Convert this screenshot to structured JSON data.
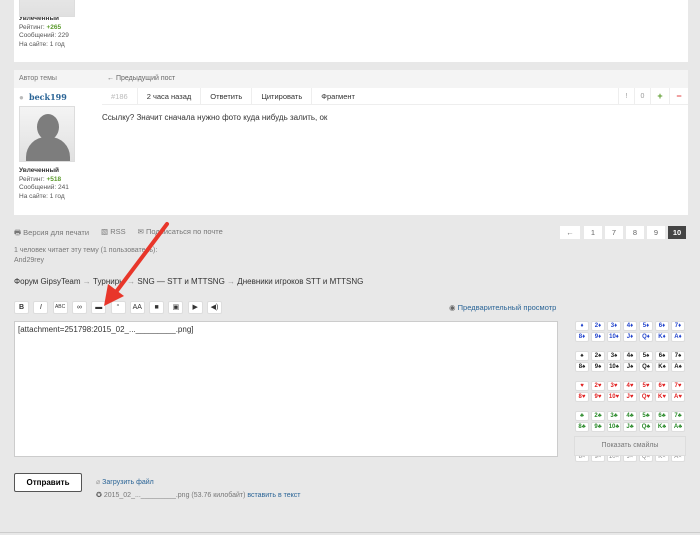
{
  "prev_user": {
    "rank": "Увлеченный",
    "rating_label": "Рейтинг:",
    "rating": "+265",
    "posts": "Сообщений: 229",
    "online": "На сайте: 1 год"
  },
  "post_header": {
    "author_label": "Автор темы",
    "prev_post": "← Предыдущий пост"
  },
  "post": {
    "username": "beck199",
    "number": "#186",
    "time": "2 часа назад",
    "reply": "Ответить",
    "quote": "Цитировать",
    "fragment": "Фрагмент",
    "vote_count": "!",
    "vote_value": "0",
    "plus": "+",
    "minus": "−",
    "text": "Ссылку? Значит сначала нужно фото куда нибудь залить, ок",
    "rank": "Увлеченный",
    "rating_label": "Рейтинг:",
    "rating": "+518",
    "posts": "Сообщений: 241",
    "online": "На сайте: 1 год"
  },
  "footer_links": {
    "print": "Версия для печати",
    "rss": "RSS",
    "subscribe": "Подписаться по почте"
  },
  "pagination": {
    "prev": "←",
    "pages": [
      "1",
      "7",
      "8",
      "9",
      "10"
    ],
    "current": "10"
  },
  "readers": {
    "text": "1 человек читает эту тему (1 пользователь):",
    "users": "And29rey"
  },
  "breadcrumb": [
    "Форум GipsyTeam",
    "Турниры",
    "SNG — STT и MTTSNG",
    "Дневники игроков STT и MTTSNG"
  ],
  "breadcrumb_sep": "→",
  "toolbar": {
    "buttons": [
      "B",
      "I",
      "ABC",
      "∞",
      "▬",
      "‘‘",
      "AA",
      "■",
      "▣",
      "▶",
      "◀)"
    ],
    "preview": "Предварительный просмотр"
  },
  "editor": {
    "value": "[attachment=251798:2015_02_..._________.png]"
  },
  "cards": {
    "ranks": [
      "",
      "2",
      "3",
      "4",
      "5",
      "6",
      "7",
      "8",
      "9",
      "10",
      "J",
      "Q",
      "K",
      "A"
    ],
    "suits": [
      {
        "symbol": "♦",
        "color": "#2244cc"
      },
      {
        "symbol": "♠",
        "color": "#222222"
      },
      {
        "symbol": "♥",
        "color": "#e02020"
      },
      {
        "symbol": "♣",
        "color": "#2a8a2a"
      },
      {
        "symbol": "×",
        "color": "#888888"
      }
    ],
    "show_smileys": "Показать смайлы"
  },
  "submit": {
    "label": "Отправить"
  },
  "upload": {
    "label": "Загрузить файл",
    "file": "2015_02_..._________.png (53.76 килобайт)",
    "insert": "вставить в текст"
  },
  "colors": {
    "arrow": "#e8362a",
    "link": "#2a6496",
    "rating": "#5a9a2a"
  }
}
